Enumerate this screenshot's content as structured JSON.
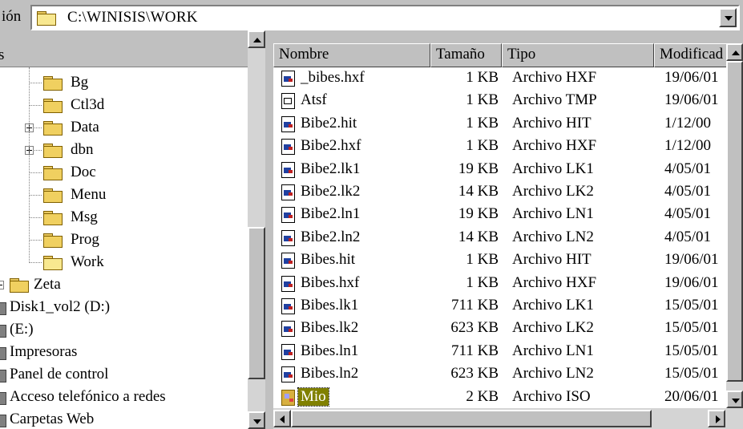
{
  "address_bar": {
    "label": "ión",
    "path": "C:\\WINISIS\\WORK"
  },
  "tree": {
    "header": "s",
    "items": [
      {
        "label": "Bg",
        "icon": "folder-icon",
        "expander": "none"
      },
      {
        "label": "Ctl3d",
        "icon": "folder-icon",
        "expander": "none"
      },
      {
        "label": "Data",
        "icon": "folder-icon",
        "expander": "plus"
      },
      {
        "label": "dbn",
        "icon": "folder-icon",
        "expander": "plus"
      },
      {
        "label": "Doc",
        "icon": "folder-icon",
        "expander": "none"
      },
      {
        "label": "Menu",
        "icon": "folder-icon",
        "expander": "none"
      },
      {
        "label": "Msg",
        "icon": "folder-icon",
        "expander": "none"
      },
      {
        "label": "Prog",
        "icon": "folder-icon",
        "expander": "none"
      },
      {
        "label": "Work",
        "icon": "open-folder-icon",
        "expander": "none"
      },
      {
        "label": "Zeta",
        "icon": "folder-icon",
        "expander": "plus"
      },
      {
        "label": "Disk1_vol2 (D:)",
        "icon": "cd-drive-icon",
        "expander": "none"
      },
      {
        "label": "(E:)",
        "icon": "drive-icon",
        "expander": "none"
      },
      {
        "label": "Impresoras",
        "icon": "printers-icon",
        "expander": "none"
      },
      {
        "label": "Panel de control",
        "icon": "control-panel-icon",
        "expander": "none"
      },
      {
        "label": "Acceso telefónico a redes",
        "icon": "dialup-icon",
        "expander": "none"
      },
      {
        "label": "Carpetas Web",
        "icon": "web-folders-icon",
        "expander": "none"
      }
    ]
  },
  "file_list": {
    "columns": [
      "Nombre",
      "Tamaño",
      "Tipo",
      "Modificad"
    ],
    "rows": [
      {
        "name": "_bibes.hxf",
        "size": "1 KB",
        "type": "Archivo HXF",
        "modified": "19/06/01",
        "icon": "file-icon"
      },
      {
        "name": "Atsf",
        "size": "1 KB",
        "type": "Archivo TMP",
        "modified": "19/06/01",
        "icon": "tmp-file-icon"
      },
      {
        "name": "Bibe2.hit",
        "size": "1 KB",
        "type": "Archivo HIT",
        "modified": "1/12/00",
        "icon": "file-icon"
      },
      {
        "name": "Bibe2.hxf",
        "size": "1 KB",
        "type": "Archivo HXF",
        "modified": "1/12/00",
        "icon": "file-icon"
      },
      {
        "name": "Bibe2.lk1",
        "size": "19 KB",
        "type": "Archivo LK1",
        "modified": "4/05/01",
        "icon": "file-icon"
      },
      {
        "name": "Bibe2.lk2",
        "size": "14 KB",
        "type": "Archivo LK2",
        "modified": "4/05/01",
        "icon": "file-icon"
      },
      {
        "name": "Bibe2.ln1",
        "size": "19 KB",
        "type": "Archivo LN1",
        "modified": "4/05/01",
        "icon": "file-icon"
      },
      {
        "name": "Bibe2.ln2",
        "size": "14 KB",
        "type": "Archivo LN2",
        "modified": "4/05/01",
        "icon": "file-icon"
      },
      {
        "name": "Bibes.hit",
        "size": "1 KB",
        "type": "Archivo HIT",
        "modified": "19/06/01",
        "icon": "file-icon"
      },
      {
        "name": "Bibes.hxf",
        "size": "1 KB",
        "type": "Archivo HXF",
        "modified": "19/06/01",
        "icon": "file-icon"
      },
      {
        "name": "Bibes.lk1",
        "size": "711 KB",
        "type": "Archivo LK1",
        "modified": "15/05/01",
        "icon": "file-icon"
      },
      {
        "name": "Bibes.lk2",
        "size": "623 KB",
        "type": "Archivo LK2",
        "modified": "15/05/01",
        "icon": "file-icon"
      },
      {
        "name": "Bibes.ln1",
        "size": "711 KB",
        "type": "Archivo LN1",
        "modified": "15/05/01",
        "icon": "file-icon"
      },
      {
        "name": "Bibes.ln2",
        "size": "623 KB",
        "type": "Archivo LN2",
        "modified": "15/05/01",
        "icon": "file-icon"
      },
      {
        "name": "Mio",
        "size": "2 KB",
        "type": "Archivo ISO",
        "modified": "20/06/01",
        "icon": "iso-file-icon",
        "selected": true
      }
    ]
  },
  "colors": {
    "window_bg": "#c0c0c0",
    "pane_bg": "#ffffff",
    "selection_bg": "#808000",
    "selection_fg": "#ffffff"
  }
}
